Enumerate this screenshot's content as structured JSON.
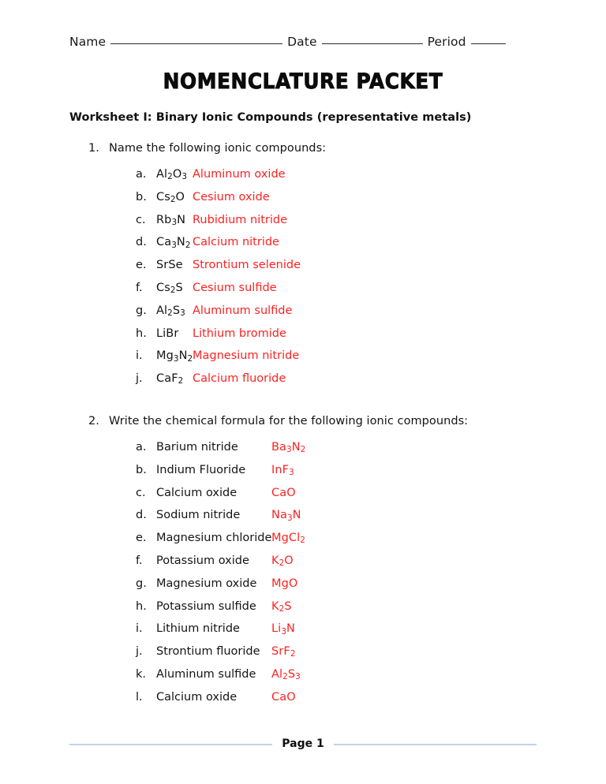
{
  "header": {
    "name_label": "Name",
    "date_label": "Date",
    "period_label": "Period"
  },
  "title": "Nomenclature Packet",
  "worksheet_heading": "Worksheet I: Binary Ionic Compounds (representative metals)",
  "questions": [
    {
      "number": "1.",
      "prompt": "Name the following ionic compounds:",
      "items": [
        {
          "letter": "a.",
          "formula": "Al<sub>2</sub>O<sub>3</sub>",
          "answer": "Aluminum oxide"
        },
        {
          "letter": "b.",
          "formula": "Cs<sub>2</sub>O",
          "answer": "Cesium oxide"
        },
        {
          "letter": "c.",
          "formula": "Rb<sub>3</sub>N",
          "answer": "Rubidium nitride"
        },
        {
          "letter": "d.",
          "formula": "Ca<sub>3</sub>N<sub>2</sub>",
          "answer": "Calcium nitride"
        },
        {
          "letter": "e.",
          "formula": "SrSe",
          "answer": "Strontium selenide"
        },
        {
          "letter": "f.",
          "formula": "Cs<sub>2</sub>S",
          "answer": "Cesium sulfide"
        },
        {
          "letter": "g.",
          "formula": "Al<sub>2</sub>S<sub>3</sub>",
          "answer": "Aluminum sulfide"
        },
        {
          "letter": "h.",
          "formula": "LiBr",
          "answer": "Lithium bromide"
        },
        {
          "letter": "i.",
          "formula": "Mg<sub>3</sub>N<sub>2</sub>",
          "answer": "Magnesium nitride"
        },
        {
          "letter": "j.",
          "formula": "CaF<sub>2</sub>",
          "answer": "Calcium fluoride"
        }
      ]
    },
    {
      "number": "2.",
      "prompt": "Write the chemical formula for the following ionic compounds:",
      "items": [
        {
          "letter": "a.",
          "label": "Barium nitride",
          "answer": "Ba<sub>3</sub>N<sub>2</sub>"
        },
        {
          "letter": "b.",
          "label": "Indium Fluoride",
          "answer": "InF<sub>3</sub>"
        },
        {
          "letter": "c.",
          "label": "Calcium oxide",
          "answer": "CaO"
        },
        {
          "letter": "d.",
          "label": "Sodium nitride",
          "answer": "Na<sub>3</sub>N"
        },
        {
          "letter": "e.",
          "label": "Magnesium chloride",
          "answer": "MgCl<sub>2</sub>"
        },
        {
          "letter": "f.",
          "label": "Potassium oxide",
          "answer": "K<sub>2</sub>O"
        },
        {
          "letter": "g.",
          "label": "Magnesium oxide",
          "answer": "MgO"
        },
        {
          "letter": "h.",
          "label": "Potassium sulfide",
          "answer": "K<sub>2</sub>S"
        },
        {
          "letter": "i.",
          "label": "Lithium nitride",
          "answer": "Li<sub>3</sub>N"
        },
        {
          "letter": "j.",
          "label": "Strontium fluoride",
          "answer": "SrF<sub>2</sub>"
        },
        {
          "letter": "k.",
          "label": "Aluminum sulfide",
          "answer": "Al<sub>2</sub>S<sub>3</sub>"
        },
        {
          "letter": "l.",
          "label": "Calcium oxide",
          "answer": "CaO"
        }
      ]
    }
  ],
  "footer": {
    "page_label": "Page 1"
  },
  "colors": {
    "answer_red": "#fc2222",
    "footer_rule": "#bfd2ea",
    "text": "#141414"
  }
}
